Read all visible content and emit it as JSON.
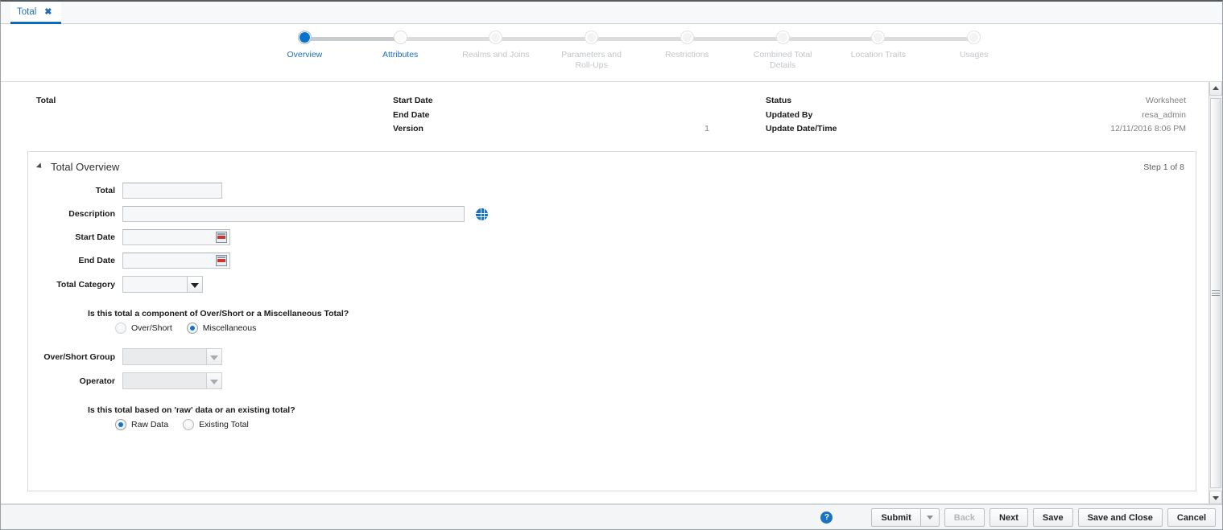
{
  "tab": {
    "label": "Total",
    "close_icon": "close-icon"
  },
  "train": {
    "steps": [
      {
        "label": "Overview",
        "state": "current"
      },
      {
        "label": "Attributes",
        "state": "enabled"
      },
      {
        "label": "Realms and Joins",
        "state": "upcoming"
      },
      {
        "label": "Parameters and\nRoll-Ups",
        "state": "upcoming"
      },
      {
        "label": "Restrictions",
        "state": "upcoming"
      },
      {
        "label": "Combined Total\nDetails",
        "state": "upcoming"
      },
      {
        "label": "Location Traits",
        "state": "upcoming"
      },
      {
        "label": "Usages",
        "state": "upcoming"
      }
    ]
  },
  "info": {
    "title": "Total",
    "col2": {
      "start_date_label": "Start Date",
      "end_date_label": "End Date",
      "version_label": "Version"
    },
    "col2_values": {
      "start_date": "",
      "end_date": "",
      "version": "1"
    },
    "col3": {
      "status_label": "Status",
      "updated_by_label": "Updated By",
      "update_datetime_label": "Update Date/Time"
    },
    "col3_values": {
      "status": "Worksheet",
      "updated_by": "resa_admin",
      "update_datetime": "12/11/2016 8:06 PM"
    }
  },
  "panel": {
    "title": "Total Overview",
    "step_count": "Step 1 of 8",
    "fields": {
      "total_label": "Total",
      "total_value": "",
      "description_label": "Description",
      "description_value": "",
      "start_date_label": "Start Date",
      "start_date_value": "",
      "end_date_label": "End Date",
      "end_date_value": "",
      "total_category_label": "Total Category",
      "total_category_value": "",
      "over_short_group_label": "Over/Short Group",
      "over_short_group_value": "",
      "operator_label": "Operator",
      "operator_value": ""
    },
    "question1": {
      "text": "Is this total a component of Over/Short or a Miscellaneous Total?",
      "option1": "Over/Short",
      "option2": "Miscellaneous",
      "selected": "Miscellaneous"
    },
    "question2": {
      "text": "Is this total based on 'raw' data or an existing total?",
      "option1": "Raw Data",
      "option2": "Existing Total",
      "selected": "Raw Data"
    }
  },
  "footer": {
    "help_glyph": "?",
    "submit": "Submit",
    "back": "Back",
    "next": "Next",
    "save": "Save",
    "save_and_close": "Save and Close",
    "cancel": "Cancel"
  },
  "colors": {
    "accent_blue": "#1d6ebd",
    "node_active": "#0572ce",
    "muted_text": "#c2c6ca",
    "value_text": "#7b7f83"
  }
}
